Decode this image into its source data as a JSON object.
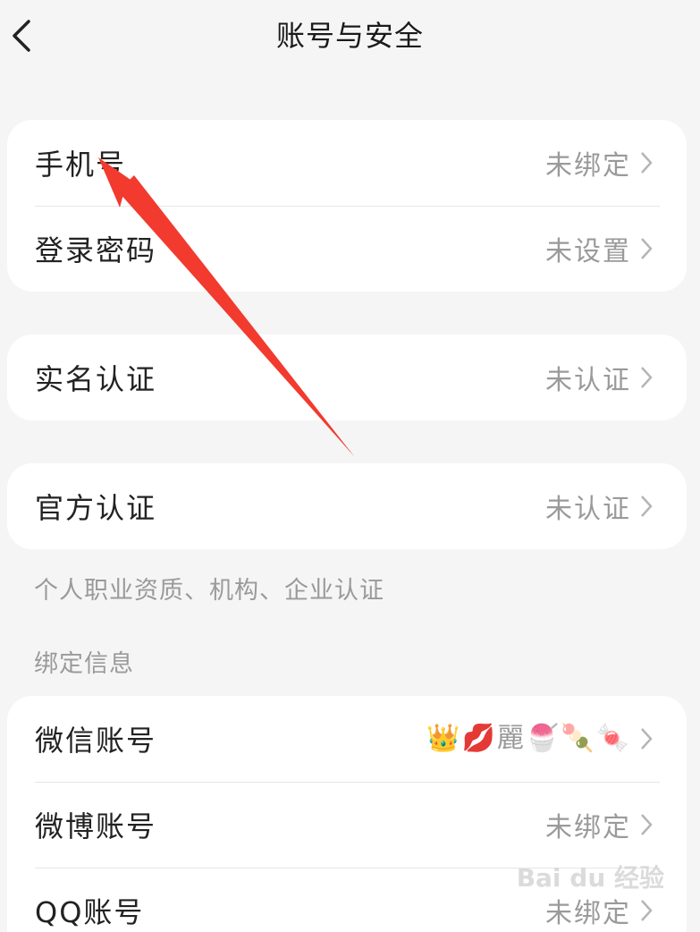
{
  "header": {
    "title": "账号与安全",
    "back_icon": "chevron-left-icon"
  },
  "security_group": {
    "rows": [
      {
        "label": "手机号",
        "value": "未绑定"
      },
      {
        "label": "登录密码",
        "value": "未设置"
      }
    ]
  },
  "realname": {
    "label": "实名认证",
    "value": "未认证"
  },
  "official": {
    "label": "官方认证",
    "value": "未认证",
    "note": "个人职业资质、机构、企业认证"
  },
  "binding": {
    "section_title": "绑定信息",
    "wechat": {
      "label": "微信账号",
      "nickname": "👑💋麗🍧🍡🍬"
    },
    "weibo": {
      "label": "微博账号",
      "value": "未绑定"
    },
    "qq": {
      "label": "QQ账号",
      "value": "未绑定"
    }
  },
  "watermark": "Bai du 经验",
  "colors": {
    "background": "#f5f5f5",
    "card": "#ffffff",
    "muted_text": "#9a9a9a",
    "annotation_arrow": "#f23a2f"
  }
}
